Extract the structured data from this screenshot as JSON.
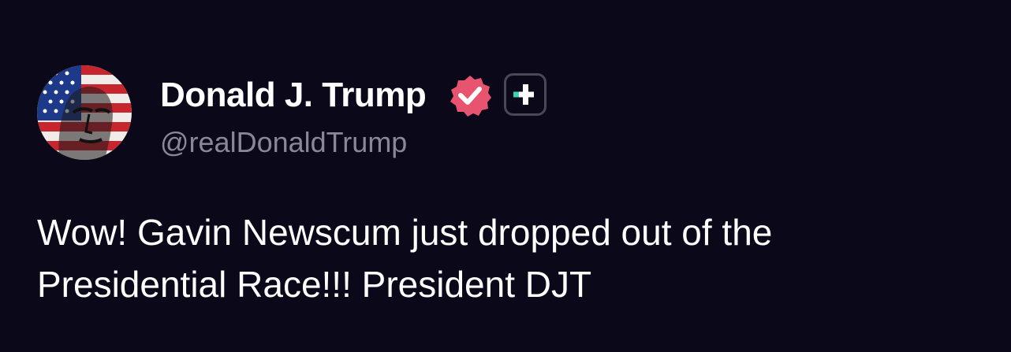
{
  "author": {
    "display_name": "Donald J. Trump",
    "handle": "@realDonaldTrump",
    "verified": true
  },
  "post": {
    "text": "Wow! Gavin Newscum just dropped out of the Presidential Race!!! President DJT"
  },
  "colors": {
    "background": "#0b0919",
    "name_text": "#ffffff",
    "handle_text": "#8a8898",
    "verified_badge": "#e8546f",
    "plus_accent": "#3bd6b5"
  },
  "icons": {
    "avatar": "flag-portrait-avatar",
    "verified": "verified-badge-icon",
    "plus": "plus-badge-icon"
  }
}
